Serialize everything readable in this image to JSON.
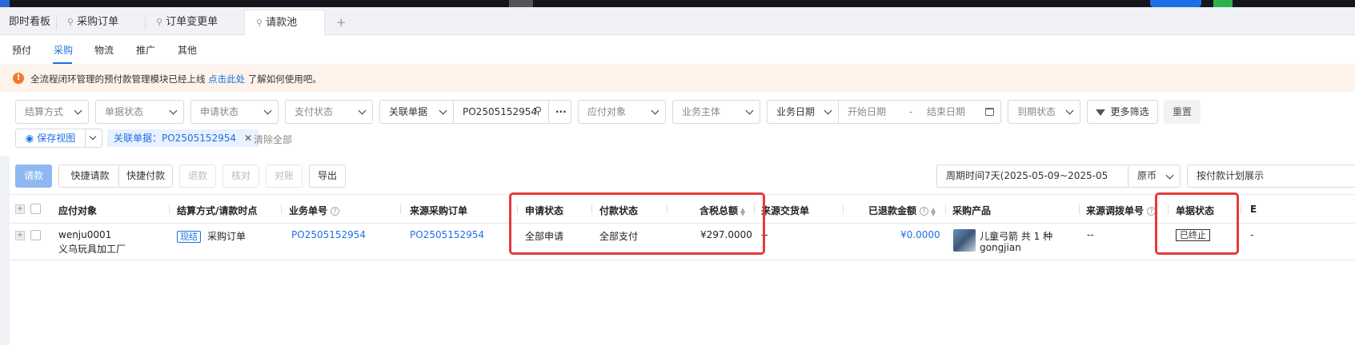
{
  "tabs": [
    {
      "label": "即时看板"
    },
    {
      "label": "采购订单"
    },
    {
      "label": "订单变更单"
    },
    {
      "label": "请款池"
    }
  ],
  "subnav": [
    "预付",
    "采购",
    "物流",
    "推广",
    "其他"
  ],
  "notice": {
    "text": "全流程闭环管理的预付款管理模块已经上线",
    "link": "点击此处",
    "suffix": "了解如何使用吧。"
  },
  "filters": {
    "settle": "结算方式",
    "doc_status": "单据状态",
    "apply_status": "申请状态",
    "pay_status": "支付状态",
    "linked_label": "关联单据",
    "linked_value": "PO2505152954",
    "payee": "应付对象",
    "entity": "业务主体",
    "date_type": "业务日期",
    "start": "开始日期",
    "sep": "-",
    "end": "结束日期",
    "due": "到期状态",
    "more": "更多筛选",
    "reset": "重置",
    "save_view": "保存视图",
    "chip": "关联单据：PO2505152954",
    "clear_all": "清除全部"
  },
  "toolbar": {
    "request": "请款",
    "quick_request": "快捷请款",
    "quick_pay": "快捷付款",
    "refund": "退款",
    "verify": "核对",
    "reconcile": "对账",
    "export": "导出",
    "period": "周期时间7天(2025-05-09~2025-05",
    "currency": "原币",
    "plan": "按付款计划展示"
  },
  "columns": {
    "payee": "应付对象",
    "settle": "结算方式/请款时点",
    "biz_no": "业务单号",
    "src_po": "来源采购订单",
    "apply": "申请状态",
    "pay": "付款状态",
    "total": "含税总额",
    "src_delivery": "来源交货单",
    "refunded": "已退款金额",
    "product": "采购产品",
    "src_transfer": "来源调拨单号",
    "doc_status": "单据状态",
    "more": "E"
  },
  "rows": [
    {
      "payee_code": "wenju0001",
      "payee_name": "义乌玩具加工厂",
      "settle_tag": "现结",
      "settle_point": "采购订单",
      "biz_no": "PO2505152954",
      "src_po": "PO2505152954",
      "apply": "全部申请",
      "pay": "全部支付",
      "total": "¥297.0000",
      "src_delivery": "--",
      "refunded": "¥0.0000",
      "product_name": "儿童弓箭 共 1 种",
      "product_sku": "gongjian",
      "src_transfer": "--",
      "doc_status": "已终止",
      "more": "-"
    }
  ],
  "colors": {
    "accent": "#1f6fe5",
    "highlight": "#e53a3a",
    "notice_bg": "#fdf3ea"
  }
}
